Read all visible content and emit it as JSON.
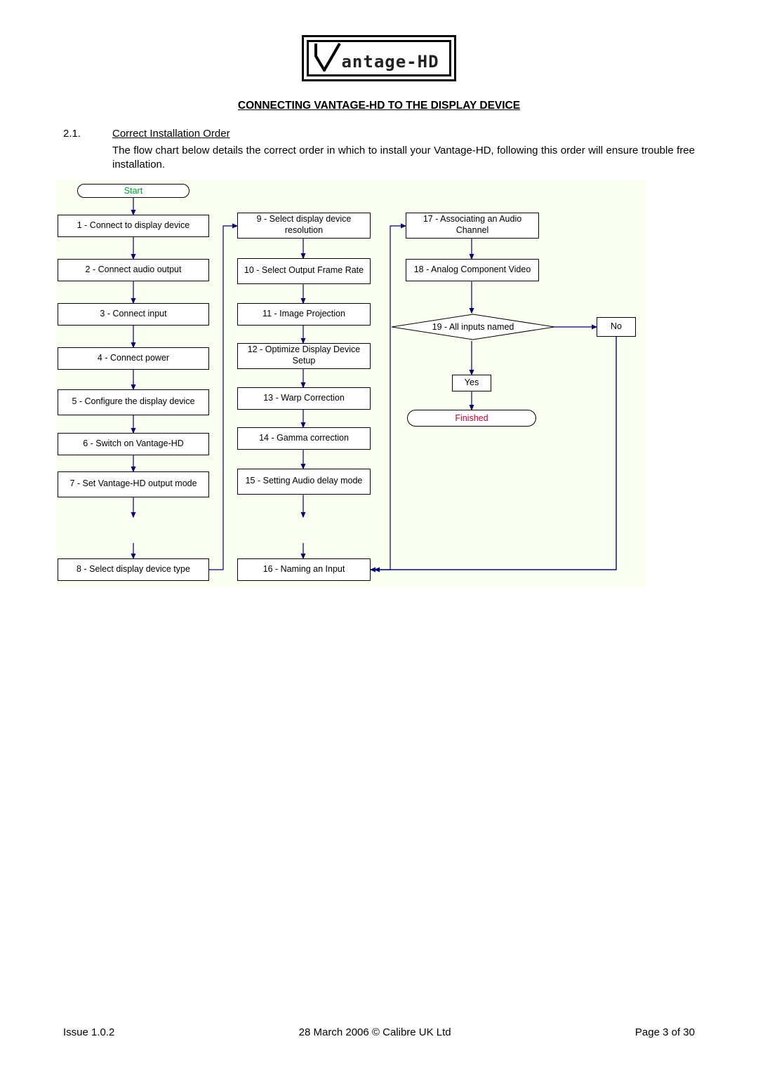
{
  "logo": {
    "text": "antage-HD"
  },
  "title": "CONNECTING VANTAGE-HD TO THE DISPLAY DEVICE",
  "section": {
    "num": "2.1.",
    "name": "Correct Installation Order",
    "para": "The flow chart below details the correct order in which to install your Vantage-HD, following this order will ensure trouble free installation."
  },
  "chart_data": {
    "type": "flowchart",
    "nodes": [
      {
        "id": "start",
        "shape": "terminator",
        "label": "Start",
        "color": "#009933"
      },
      {
        "id": "n1",
        "shape": "process",
        "label": "1 - Connect to display device"
      },
      {
        "id": "n2",
        "shape": "process",
        "label": "2 - Connect audio output"
      },
      {
        "id": "n3",
        "shape": "process",
        "label": "3 - Connect input"
      },
      {
        "id": "n4",
        "shape": "process",
        "label": "4 - Connect power"
      },
      {
        "id": "n5",
        "shape": "process",
        "label": "5 - Configure the display device"
      },
      {
        "id": "n6",
        "shape": "process",
        "label": "6 - Switch on Vantage-HD"
      },
      {
        "id": "n7",
        "shape": "process",
        "label": "7 - Set Vantage-HD output mode"
      },
      {
        "id": "n8",
        "shape": "process",
        "label": "8 - Select display device type"
      },
      {
        "id": "n9",
        "shape": "process",
        "label": "9 - Select display device resolution"
      },
      {
        "id": "n10",
        "shape": "process",
        "label": "10 - Select Output Frame Rate"
      },
      {
        "id": "n11",
        "shape": "process",
        "label": "11 - Image Projection"
      },
      {
        "id": "n12",
        "shape": "process",
        "label": "12 - Optimize Display Device Setup"
      },
      {
        "id": "n13",
        "shape": "process",
        "label": "13 - Warp Correction"
      },
      {
        "id": "n14",
        "shape": "process",
        "label": "14 - Gamma correction"
      },
      {
        "id": "n15",
        "shape": "process",
        "label": "15 - Setting Audio delay mode"
      },
      {
        "id": "n16",
        "shape": "process",
        "label": "16 - Naming an Input"
      },
      {
        "id": "n17",
        "shape": "process",
        "label": "17 - Associating an Audio Channel"
      },
      {
        "id": "n18",
        "shape": "process",
        "label": "18 - Analog Component Video"
      },
      {
        "id": "n19",
        "shape": "decision",
        "label": "19 - All inputs named"
      },
      {
        "id": "yes",
        "shape": "process",
        "label": "Yes"
      },
      {
        "id": "no",
        "shape": "process",
        "label": "No"
      },
      {
        "id": "finished",
        "shape": "terminator",
        "label": "Finished",
        "color": "#cc0033"
      }
    ],
    "edges": [
      [
        "start",
        "n1"
      ],
      [
        "n1",
        "n2"
      ],
      [
        "n2",
        "n3"
      ],
      [
        "n3",
        "n4"
      ],
      [
        "n4",
        "n5"
      ],
      [
        "n5",
        "n6"
      ],
      [
        "n6",
        "n7"
      ],
      [
        "n7",
        "n8"
      ],
      [
        "n8",
        "n9"
      ],
      [
        "n9",
        "n10"
      ],
      [
        "n10",
        "n11"
      ],
      [
        "n11",
        "n12"
      ],
      [
        "n12",
        "n13"
      ],
      [
        "n13",
        "n14"
      ],
      [
        "n14",
        "n15"
      ],
      [
        "n15",
        "n16"
      ],
      [
        "n16",
        "n17"
      ],
      [
        "n17",
        "n18"
      ],
      [
        "n18",
        "n19"
      ],
      [
        "n19",
        "no",
        "No"
      ],
      [
        "no",
        "n16"
      ],
      [
        "n19",
        "yes",
        "Yes"
      ],
      [
        "yes",
        "finished"
      ]
    ]
  },
  "footer": {
    "left": "Issue 1.0.2",
    "center": "28 March 2006 © Calibre UK Ltd",
    "right": "Page 3 of 30"
  }
}
